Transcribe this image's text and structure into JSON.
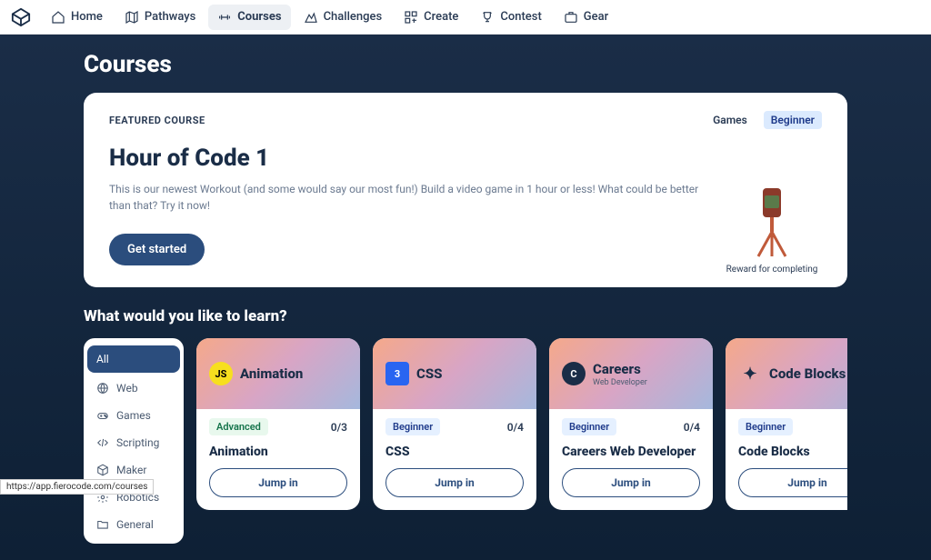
{
  "nav": {
    "items": [
      {
        "label": "Home"
      },
      {
        "label": "Pathways"
      },
      {
        "label": "Courses"
      },
      {
        "label": "Challenges"
      },
      {
        "label": "Create"
      },
      {
        "label": "Contest"
      },
      {
        "label": "Gear"
      }
    ]
  },
  "page_title": "Courses",
  "featured": {
    "label": "FEATURED COURSE",
    "tags": [
      "Games",
      "Beginner"
    ],
    "title": "Hour of Code 1",
    "description": "This is our newest Workout (and some would say our most fun!) Build a video game in 1 hour or less! What could be better than that? Try it now!",
    "cta": "Get started",
    "reward_label": "Reward for completing"
  },
  "section_heading": "What would you like to learn?",
  "sidebar": {
    "items": [
      {
        "label": "All"
      },
      {
        "label": "Web"
      },
      {
        "label": "Games"
      },
      {
        "label": "Scripting"
      },
      {
        "label": "Maker"
      },
      {
        "label": "Robotics"
      },
      {
        "label": "General"
      }
    ]
  },
  "courses": [
    {
      "icon": "JS",
      "icon_bg": "#f7df1e",
      "icon_color": "#000",
      "head_title": "Animation",
      "head_sub": "",
      "level": "Advanced",
      "progress": "0/3",
      "title": "Animation",
      "cta": "Jump in"
    },
    {
      "icon": "3",
      "icon_bg": "#2965f1",
      "icon_color": "#fff",
      "head_title": "CSS",
      "head_sub": "",
      "level": "Beginner",
      "progress": "0/4",
      "title": "CSS",
      "cta": "Jump in"
    },
    {
      "icon": "C",
      "icon_bg": "#1a2d47",
      "icon_color": "#fff",
      "head_title": "Careers",
      "head_sub": "Web Developer",
      "level": "Beginner",
      "progress": "0/4",
      "title": "Careers Web Developer",
      "cta": "Jump in"
    },
    {
      "icon": "✦",
      "icon_bg": "#1a2d47",
      "icon_color": "#fff",
      "head_title": "Code Blocks",
      "head_sub": "",
      "level": "Beginner",
      "progress": "",
      "title": "Code Blocks",
      "cta": "Jump in"
    }
  ],
  "status_url": "https://app.fierocode.com/courses"
}
